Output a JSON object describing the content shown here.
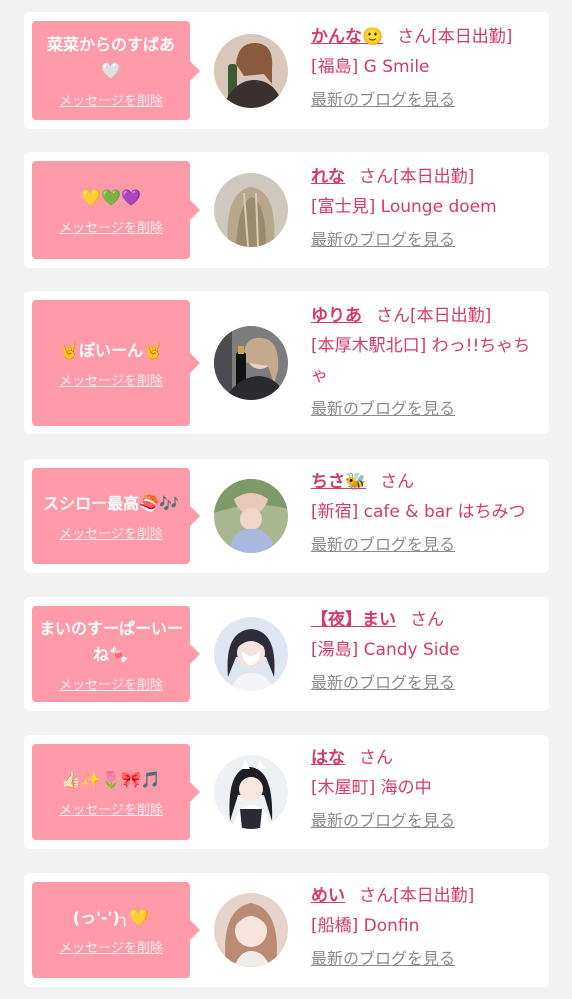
{
  "colors": {
    "bubble": "#ff9aa8",
    "accent": "#d63a66",
    "link_gray": "#8c8c8c",
    "background": "#f2f2f2"
  },
  "cards": [
    {
      "message": "菜菜からのすばあ🤍",
      "delete_label": "メッセージを削除",
      "name": "かんな🙂",
      "san": "さん",
      "status": "[本日出勤]",
      "shop": "[福島] G Smile",
      "blog_link": "最新のブログを見る",
      "avatar_icon": "profile-photo"
    },
    {
      "message": "💛💚💜",
      "delete_label": "メッセージを削除",
      "name": "れな",
      "san": "さん",
      "status": "[本日出勤]",
      "shop": "[富士見] Lounge doem",
      "blog_link": "最新のブログを見る",
      "avatar_icon": "profile-photo"
    },
    {
      "message": "🤘ぽいーん🤘",
      "delete_label": "メッセージを削除",
      "name": "ゆりあ",
      "san": "さん",
      "status": "[本日出勤]",
      "shop": "[本厚木駅北口] わっ!!ちゃちゃ",
      "blog_link": "最新のブログを見る",
      "avatar_icon": "profile-photo"
    },
    {
      "message": "スシロー最高🍣🎶",
      "delete_label": "メッセージを削除",
      "name": "ちさ🐝",
      "san": "さん",
      "status": "",
      "shop": "[新宿] cafe & bar はちみつ",
      "blog_link": "最新のブログを見る",
      "avatar_icon": "profile-photo"
    },
    {
      "message": "まいのすーぱーいーね🍬",
      "delete_label": "メッセージを削除",
      "name": "【夜】まい",
      "san": "さん",
      "status": "",
      "shop": "[湯島] Candy Side",
      "blog_link": "最新のブログを見る",
      "avatar_icon": "profile-photo"
    },
    {
      "message": "👍🏻✨🌷🎀🎵",
      "delete_label": "メッセージを削除",
      "name": "はな",
      "san": "さん",
      "status": "",
      "shop": "[木屋町] 海の中",
      "blog_link": "最新のブログを見る",
      "avatar_icon": "profile-photo"
    },
    {
      "message": "(っ'-')╮💛",
      "delete_label": "メッセージを削除",
      "name": "めい",
      "san": "さん",
      "status": "[本日出勤]",
      "shop": "[船橋] Donfin",
      "blog_link": "最新のブログを見る",
      "avatar_icon": "profile-photo"
    }
  ]
}
